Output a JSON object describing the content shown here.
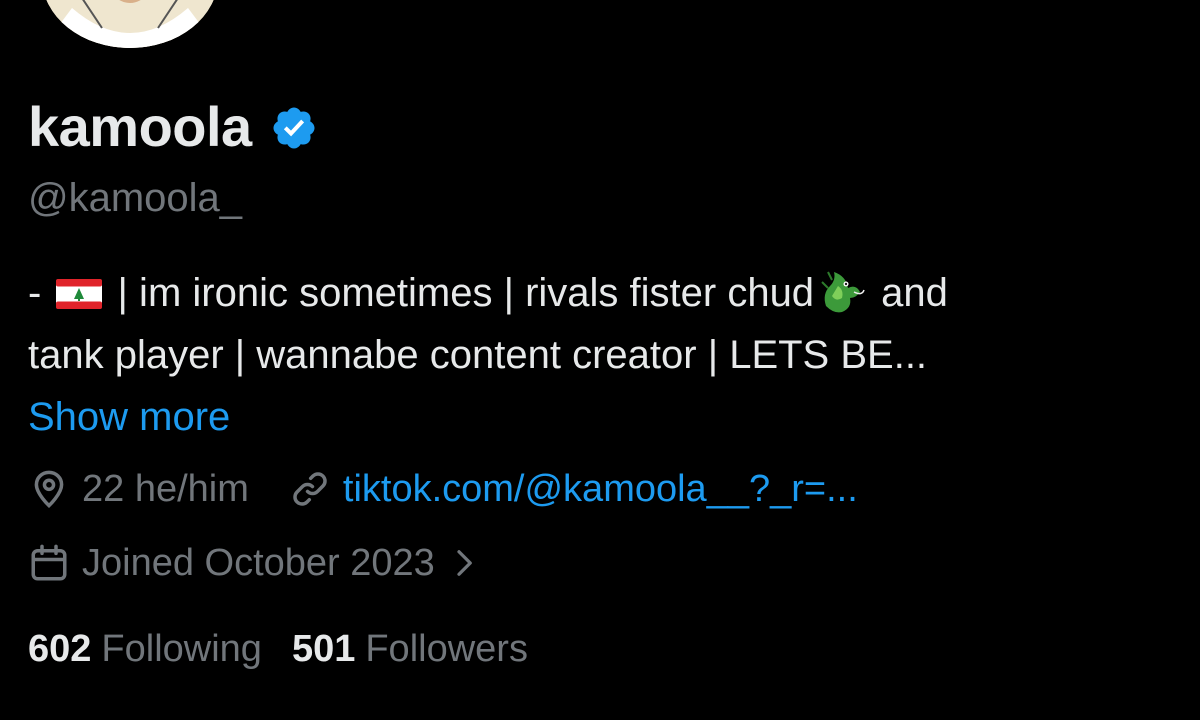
{
  "profile": {
    "display_name": "kamoola",
    "handle": "@kamoola_",
    "verified_color": "#1d9bf0"
  },
  "bio": {
    "line1_prefix": "- ",
    "line1_text": " | im ironic sometimes | rivals fister chud",
    "line1_suffix": " and",
    "line2": "tank player | wannabe content creator | LETS BE...",
    "show_more": "Show more"
  },
  "meta": {
    "location": "22 he/him",
    "link": "tiktok.com/@kamoola__?_r=...",
    "joined": "Joined October 2023"
  },
  "stats": {
    "following_count": "602",
    "following_label": "Following",
    "followers_count": "501",
    "followers_label": "Followers"
  },
  "icons": {
    "location": "location-pin-icon",
    "link": "link-icon",
    "calendar": "calendar-icon",
    "chevron": "chevron-right-icon",
    "flag": "lebanon-flag-icon",
    "dragon": "dragon-emoji-icon",
    "verified": "verified-badge-icon"
  },
  "colors": {
    "background": "#000000",
    "primary_text": "#e7e9ea",
    "secondary_text": "#71767b",
    "accent": "#1d9bf0"
  }
}
